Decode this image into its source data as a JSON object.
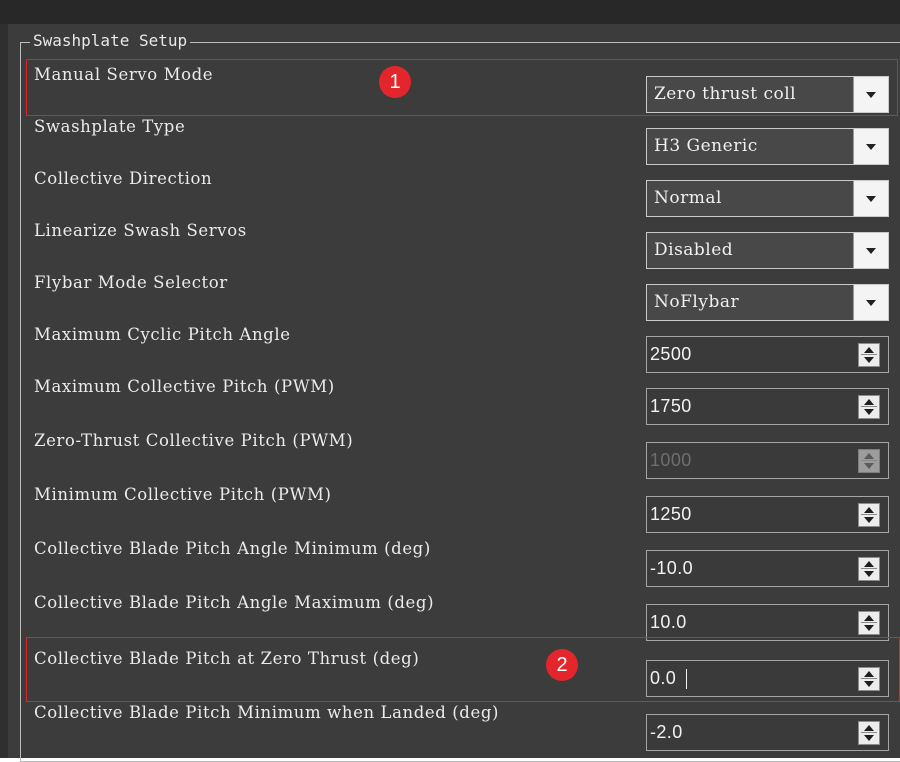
{
  "group": {
    "title": "Swashplate Setup"
  },
  "rows": [
    {
      "label": "Manual Servo Mode",
      "type": "combo",
      "value": "Zero thrust coll"
    },
    {
      "label": "Swashplate Type",
      "type": "combo",
      "value": "H3 Generic"
    },
    {
      "label": "Collective Direction",
      "type": "combo",
      "value": "Normal"
    },
    {
      "label": "Linearize Swash Servos",
      "type": "combo",
      "value": "Disabled"
    },
    {
      "label": "Flybar Mode Selector",
      "type": "combo",
      "value": "NoFlybar"
    },
    {
      "label": "Maximum Cyclic Pitch Angle",
      "type": "spin",
      "value": "2500"
    },
    {
      "label": "Maximum Collective Pitch (PWM)",
      "type": "spin",
      "value": "1750"
    },
    {
      "label": "Zero-Thrust Collective Pitch (PWM)",
      "type": "spin",
      "value": "1000",
      "enabled": false
    },
    {
      "label": "Minimum Collective Pitch (PWM)",
      "type": "spin",
      "value": "1250"
    },
    {
      "label": "Collective Blade Pitch Angle Minimum (deg)",
      "type": "spin",
      "value": "-10.0"
    },
    {
      "label": "Collective Blade Pitch Angle Maximum (deg)",
      "type": "spin",
      "value": "10.0"
    },
    {
      "label": "Collective Blade Pitch at Zero Thrust (deg)",
      "type": "spin",
      "value": "0.0"
    },
    {
      "label": "Collective Blade Pitch Minimum when Landed (deg)",
      "type": "spin",
      "value": "-2.0"
    }
  ],
  "annotations": [
    {
      "number": "1"
    },
    {
      "number": "2"
    }
  ],
  "colors": {
    "annotation_red": "#e3262c",
    "panel_background": "#3c3c3c"
  }
}
